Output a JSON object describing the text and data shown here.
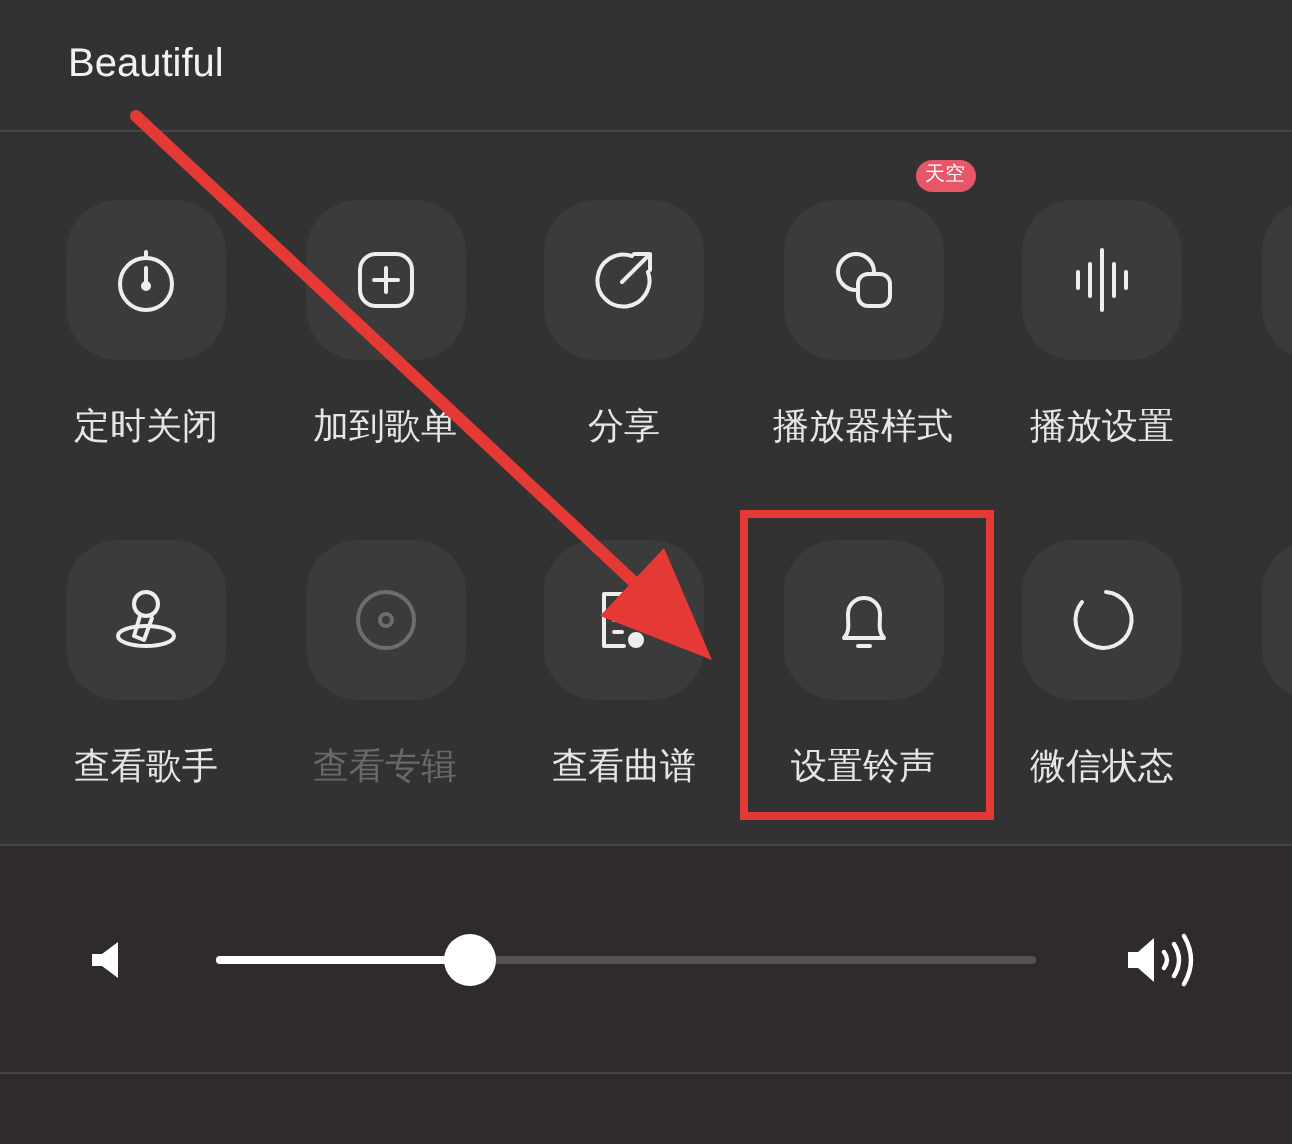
{
  "title": "Beautiful",
  "rows": [
    {
      "more": true,
      "items": [
        {
          "label": "定时关闭",
          "kind": "timer",
          "disabled": false
        },
        {
          "label": "加到歌单",
          "kind": "add",
          "disabled": false
        },
        {
          "label": "分享",
          "kind": "share",
          "disabled": false
        },
        {
          "label": "播放器样式",
          "kind": "style",
          "disabled": false,
          "badge": "天空"
        },
        {
          "label": "播放设置",
          "kind": "wave",
          "disabled": false
        }
      ]
    },
    {
      "more": true,
      "items": [
        {
          "label": "查看歌手",
          "kind": "singer",
          "disabled": false
        },
        {
          "label": "查看专辑",
          "kind": "disc",
          "disabled": true
        },
        {
          "label": "查看曲谱",
          "kind": "score",
          "disabled": false
        },
        {
          "label": "设置铃声",
          "kind": "bell",
          "disabled": false,
          "highlighted": true
        },
        {
          "label": "微信状态",
          "kind": "circle",
          "disabled": false
        }
      ]
    }
  ],
  "volume": {
    "level": 0.31
  },
  "arrow": true
}
